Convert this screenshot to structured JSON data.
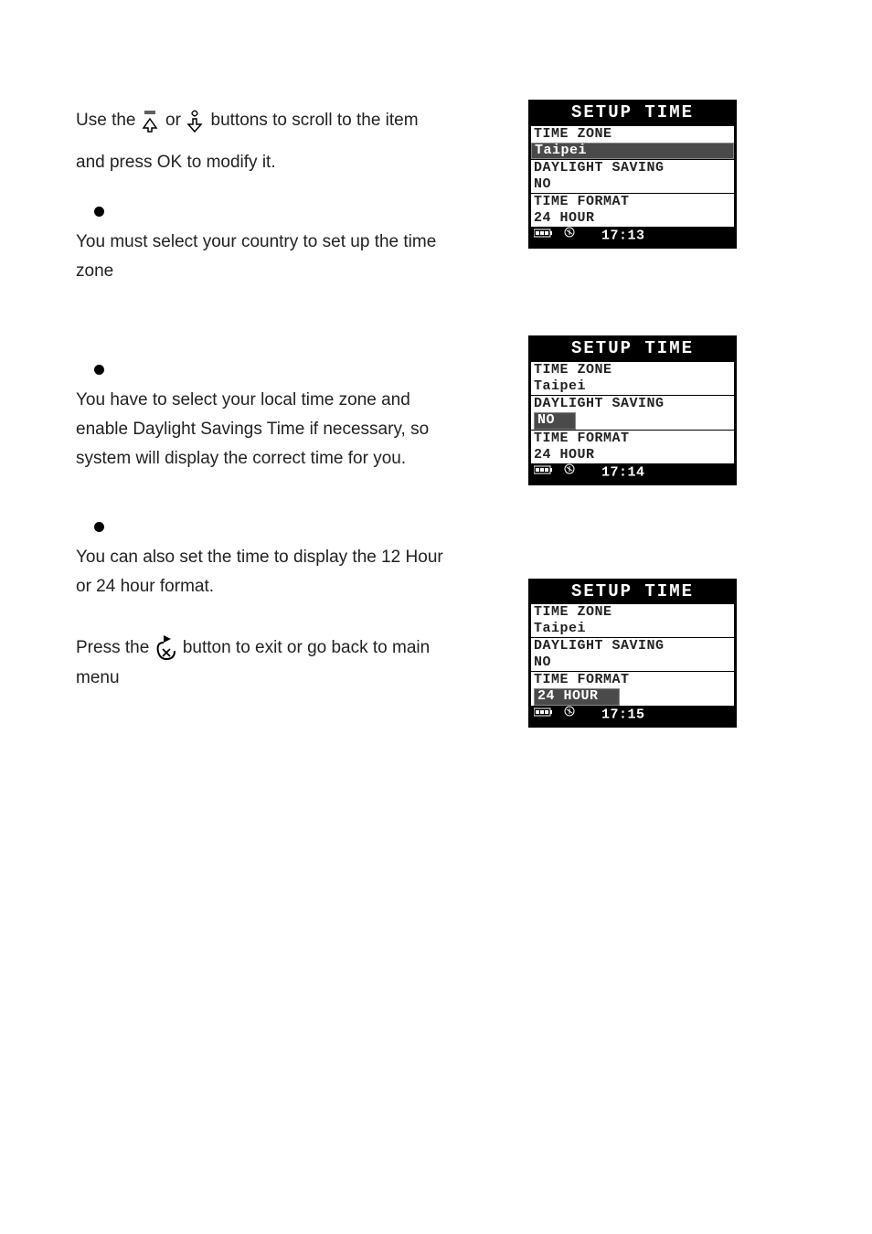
{
  "intro": {
    "part1": "Use the",
    "part2": "or",
    "part3": "buttons to scroll to the item and press OK to modify it."
  },
  "sections": [
    {
      "text": "You must select your country to set up the time zone"
    },
    {
      "text": "You have to select your local time zone and enable Daylight Savings Time if necessary, so system will display the correct time for you."
    },
    {
      "text": "You can also set the time to display the 12 Hour or 24 hour format."
    }
  ],
  "exit": {
    "part1": "Press the",
    "part2": "button to exit or go back to main menu"
  },
  "screens": [
    {
      "header": "SETUP TIME",
      "row1_label": "TIME ZONE",
      "row1_value": "Taipei",
      "row1_highlight": "full",
      "row2_label": "DAYLIGHT SAVING",
      "row2_value": "NO",
      "row2_highlight": "none",
      "row3_label": "TIME FORMAT",
      "row3_value": "24 HOUR",
      "row3_highlight": "none",
      "footer_time": "17:13"
    },
    {
      "header": "SETUP TIME",
      "row1_label": "TIME ZONE",
      "row1_value": "Taipei",
      "row1_highlight": "none",
      "row2_label": "DAYLIGHT SAVING",
      "row2_value": "NO",
      "row2_highlight": "short",
      "row3_label": "TIME FORMAT",
      "row3_value": "24 HOUR",
      "row3_highlight": "none",
      "footer_time": "17:14"
    },
    {
      "header": "SETUP TIME",
      "row1_label": "TIME ZONE",
      "row1_value": "Taipei",
      "row1_highlight": "none",
      "row2_label": "DAYLIGHT SAVING",
      "row2_value": "NO",
      "row2_highlight": "none",
      "row3_label": "TIME FORMAT",
      "row3_value": "24 HOUR",
      "row3_highlight": "short",
      "footer_time": "17:15"
    }
  ]
}
